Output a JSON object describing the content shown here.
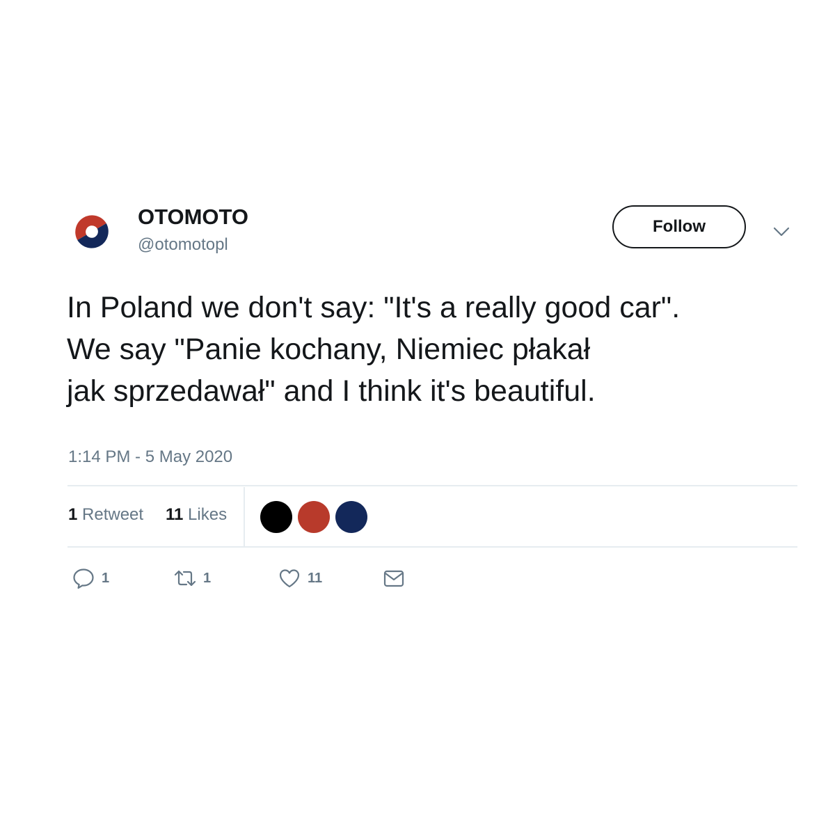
{
  "colors": {
    "avatar_red": "#c0392b",
    "avatar_navy": "#13285a",
    "text_primary": "#14171a",
    "text_secondary": "#657786",
    "divider": "#e6ecf0"
  },
  "author": {
    "display_name": "OTOMOTO",
    "handle": "@otomotopl",
    "avatar_icon": "otomoto-logo-icon"
  },
  "header": {
    "follow_label": "Follow",
    "more_icon": "chevron-down-icon"
  },
  "tweet": {
    "lines": [
      "In Poland we don't say: \"It's a really good car\".",
      "We say \"Panie kochany, Niemiec płakał",
      "jak sprzedawał\" and I think it's beautiful."
    ],
    "timestamp": "1:14 PM - 5 May 2020"
  },
  "stats": {
    "retweet_count": "1",
    "retweet_label": "Retweet",
    "like_count": "11",
    "like_label": "Likes",
    "liker_colors": [
      "#000000",
      "#b83a2b",
      "#13285a"
    ]
  },
  "actions": {
    "reply": {
      "icon": "reply-icon",
      "count": "1"
    },
    "retweet": {
      "icon": "retweet-icon",
      "count": "1"
    },
    "like": {
      "icon": "heart-icon",
      "count": "11"
    },
    "dm": {
      "icon": "envelope-icon"
    }
  }
}
